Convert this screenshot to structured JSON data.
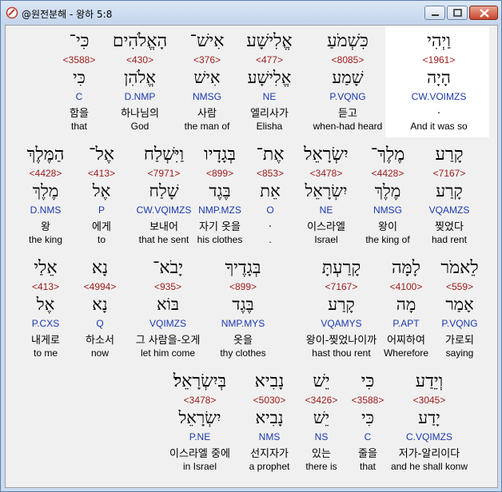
{
  "window": {
    "title": "@원전분해 - 왕하 5:8"
  },
  "rows": [
    {
      "words": [
        {
          "heb": "וַיְהִי",
          "strong": "<1961>",
          "lemma": "הָיָה",
          "morph": "CW.VOIMZS",
          "kor": ".",
          "eng": "And it was so"
        },
        {
          "heb": "כִּשְׁמֹעַ",
          "strong": "<8085>",
          "lemma": "שָׁמַע",
          "morph": "P.VQNG",
          "kor": "듣고",
          "eng": "when-had heard"
        },
        {
          "heb": "אֱלִישָׁע",
          "strong": "<477>",
          "lemma": "אֱלִישָׁע",
          "morph": "NE",
          "kor": "엘리사가",
          "eng": "Elisha"
        },
        {
          "heb": "אִישׁ־",
          "strong": "<376>",
          "lemma": "אִישׁ",
          "morph": "NMSG",
          "kor": "사람",
          "eng": "the man of"
        },
        {
          "heb": "הָאֱלֹהִים",
          "strong": "<430>",
          "lemma": "אֱלֹהִן",
          "morph": "D.NMP",
          "kor": "하나님의",
          "eng": "God"
        },
        {
          "heb": "כִּי־",
          "strong": "<3588>",
          "lemma": "כִּי",
          "morph": "C",
          "kor": "함을",
          "eng": "that"
        }
      ]
    },
    {
      "words": [
        {
          "heb": "קָרַע",
          "strong": "<7167>",
          "lemma": "קָרַע",
          "morph": "VQAMZS",
          "kor": "찢었다",
          "eng": "had rent"
        },
        {
          "heb": "מֶלֶךְ־",
          "strong": "<4428>",
          "lemma": "מֶלֶךְ",
          "morph": "NMSG",
          "kor": "왕이",
          "eng": "the king of"
        },
        {
          "heb": "יִשְׂרָאֵל",
          "strong": "<3478>",
          "lemma": "יִשְׂרָאֵל",
          "morph": "NE",
          "kor": "이스라엘",
          "eng": "Israel"
        },
        {
          "heb": "אֶת־",
          "strong": "<853>",
          "lemma": "אֵת",
          "morph": "O",
          "kor": ".",
          "eng": "."
        },
        {
          "heb": "בְּגָדָיו",
          "strong": "<899>",
          "lemma": "בֶּגֶד",
          "morph": "NMP.MZS",
          "kor": "자기 옷을",
          "eng": "his clothes"
        },
        {
          "heb": "וַיִּשְׁלַח",
          "strong": "<7971>",
          "lemma": "שָׁלַח",
          "morph": "CW.VQIMZS",
          "kor": "보내어",
          "eng": "that he sent"
        },
        {
          "heb": "אֶל־",
          "strong": "<413>",
          "lemma": "אֶל",
          "morph": "P",
          "kor": "에게",
          "eng": "to"
        },
        {
          "heb": "הַמֶּלֶךְ",
          "strong": "<4428>",
          "lemma": "מֶלֶךְ",
          "morph": "D.NMS",
          "kor": "왕",
          "eng": "the king"
        }
      ]
    },
    {
      "words": [
        {
          "heb": "לֵאמֹר",
          "strong": "<559>",
          "lemma": "אָמַר",
          "morph": "P.VQNG",
          "kor": "가로되",
          "eng": "saying"
        },
        {
          "heb": "לָמָּה",
          "strong": "<4100>",
          "lemma": "מָה",
          "morph": "P.APT",
          "kor": "어찌하여",
          "eng": "Wherefore"
        },
        {
          "heb": "קָרַעְתָּ",
          "strong": "<7167>",
          "lemma": "קָרַע",
          "morph": "VQAMYS",
          "kor": "왕이-찢었나이까",
          "eng": "hast thou rent"
        },
        {
          "heb": "בְּגָדֶיךָ",
          "strong": "<899>",
          "lemma": "בֶּגֶד",
          "morph": "NMP.MYS",
          "kor": "옷을",
          "eng": "thy clothes"
        },
        {
          "heb": "יָבֹא־",
          "strong": "<935>",
          "lemma": "בּוֹא",
          "morph": "VQIMZS",
          "kor": "그 사람을-오게",
          "eng": "let him come"
        },
        {
          "heb": "נָא",
          "strong": "<4994>",
          "lemma": "נָא",
          "morph": "Q",
          "kor": "하소서",
          "eng": "now"
        },
        {
          "heb": "אֵלַי",
          "strong": "<413>",
          "lemma": "אֶל",
          "morph": "P.CXS",
          "kor": "내게로",
          "eng": "to me"
        }
      ]
    },
    {
      "words": [
        {
          "heb": "וְיֵדַע",
          "strong": "<3045>",
          "lemma": "יָדַע",
          "morph": "C.VQIMZS",
          "kor": "저가-알리이다",
          "eng": "and he shall konw"
        },
        {
          "heb": "כִּי",
          "strong": "<3588>",
          "lemma": "כִּי",
          "morph": "C",
          "kor": "줄을",
          "eng": "that"
        },
        {
          "heb": "יֵשׁ",
          "strong": "<3426>",
          "lemma": "יֵשׁ",
          "morph": "NS",
          "kor": "있는",
          "eng": "there is"
        },
        {
          "heb": "נָבִיא",
          "strong": "<5030>",
          "lemma": "נָבִיא",
          "morph": "NMS",
          "kor": "선지자가",
          "eng": "a prophet"
        },
        {
          "heb": "בְּיִשְׂרָאֵל׃",
          "strong": "<3478>",
          "lemma": "יִשְׂרָאֵל",
          "morph": "P.NE",
          "kor": "이스라엘 중에",
          "eng": "in Israel"
        }
      ]
    }
  ],
  "colors": {
    "strong": "#9b1b1b",
    "morph": "#1c3aa8",
    "highlight": "#ffffff"
  },
  "icons": {
    "app": "bible-app-icon",
    "minimize": "minimize-icon",
    "maximize": "maximize-icon",
    "close": "close-icon"
  }
}
